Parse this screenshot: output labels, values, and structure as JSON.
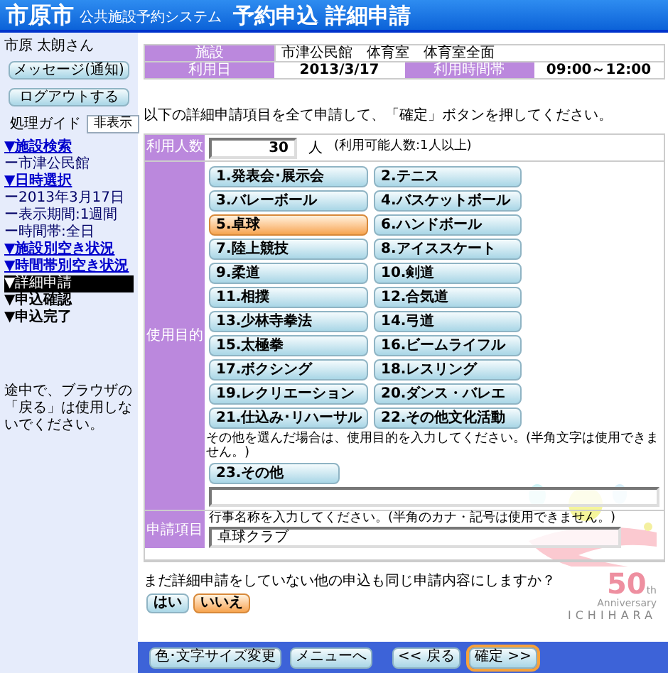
{
  "header": {
    "city": "市原市",
    "system": "公共施設予約システム",
    "title": "予約申込 詳細申請"
  },
  "sidebar": {
    "user": "市原 太朗さん",
    "buttons": [
      "メッセージ(通知)",
      "ログアウトする"
    ],
    "guide_label": "処理ガイド",
    "guide_button": "非表示",
    "nav": [
      {
        "kind": "link",
        "text": "▼施設検索",
        "selected": false
      },
      {
        "kind": "sub",
        "text": "ー市津公民館",
        "selected": false
      },
      {
        "kind": "link",
        "text": "▼日時選択",
        "selected": false
      },
      {
        "kind": "sub",
        "text": "ー2013年3月17日",
        "selected": false
      },
      {
        "kind": "sub",
        "text": "ー表示期間:1週間",
        "selected": false
      },
      {
        "kind": "sub",
        "text": "ー時間帯:全日",
        "selected": false
      },
      {
        "kind": "link",
        "text": "▼施設別空き状況",
        "selected": false
      },
      {
        "kind": "link",
        "text": "▼時間帯別空き状況",
        "selected": false
      },
      {
        "kind": "step",
        "text": "▼詳細申請",
        "selected": true
      },
      {
        "kind": "step",
        "text": "▼申込確認",
        "selected": false
      },
      {
        "kind": "step",
        "text": "▼申込完了",
        "selected": false
      }
    ],
    "note": "途中で、ブラウザの「戻る」は使用しないでください。"
  },
  "info": {
    "facility_label": "施設",
    "facility": "市津公民館　体育室　体育室全面",
    "date_label": "利用日",
    "date": "2013/3/17",
    "time_label": "利用時間帯",
    "time": "09:00～12:00"
  },
  "instruction": "以下の詳細申請項目を全て申請して、「確定」ボタンを押してください。",
  "people": {
    "label": "利用人数",
    "value": "30",
    "unit": "人",
    "hint": "(利用可能人数:1人以上)"
  },
  "purpose": {
    "label": "使用目的",
    "options": [
      {
        "text": "1.発表会･展示会",
        "selected": false
      },
      {
        "text": "2.テニス",
        "selected": false
      },
      {
        "text": "3.バレーボール",
        "selected": false
      },
      {
        "text": "4.バスケットボール",
        "selected": false
      },
      {
        "text": "5.卓球",
        "selected": true
      },
      {
        "text": "6.ハンドボール",
        "selected": false
      },
      {
        "text": "7.陸上競技",
        "selected": false
      },
      {
        "text": "8.アイススケート",
        "selected": false
      },
      {
        "text": "9.柔道",
        "selected": false
      },
      {
        "text": "10.剣道",
        "selected": false
      },
      {
        "text": "11.相撲",
        "selected": false
      },
      {
        "text": "12.合気道",
        "selected": false
      },
      {
        "text": "13.少林寺拳法",
        "selected": false
      },
      {
        "text": "14.弓道",
        "selected": false
      },
      {
        "text": "15.太極拳",
        "selected": false
      },
      {
        "text": "16.ビームライフル",
        "selected": false
      },
      {
        "text": "17.ボクシング",
        "selected": false
      },
      {
        "text": "18.レスリング",
        "selected": false
      },
      {
        "text": "19.レクリエーション",
        "selected": false
      },
      {
        "text": "20.ダンス・バレエ",
        "selected": false
      },
      {
        "text": "21.仕込み･リハーサル",
        "selected": false
      },
      {
        "text": "22.その他文化活動",
        "selected": false
      }
    ],
    "other_note": "その他を選んだ場合は、使用目的を入力してください。(半角文字は使用できません。)",
    "other": {
      "text": "23.その他",
      "selected": false
    }
  },
  "event": {
    "label": "申請項目",
    "note": "行事名称を入力してください。(半角のカナ・記号は使用できません。)",
    "value": "卓球クラブ"
  },
  "question": {
    "text": "まだ詳細申請をしていない他の申込も同じ申請内容にしますか？",
    "answers": [
      {
        "text": "はい",
        "selected": false
      },
      {
        "text": "いいえ",
        "selected": true
      }
    ]
  },
  "logo": {
    "number": "50",
    "suffix": "th",
    "word": "Anniversary",
    "city": "ICHIHARA"
  },
  "footer": [
    {
      "text": "色･文字サイズ変更",
      "selected": false
    },
    {
      "text": "メニューへ",
      "selected": false
    },
    {
      "text": "<< 戻る",
      "selected": false
    },
    {
      "text": "確定 >>",
      "selected": true
    }
  ]
}
